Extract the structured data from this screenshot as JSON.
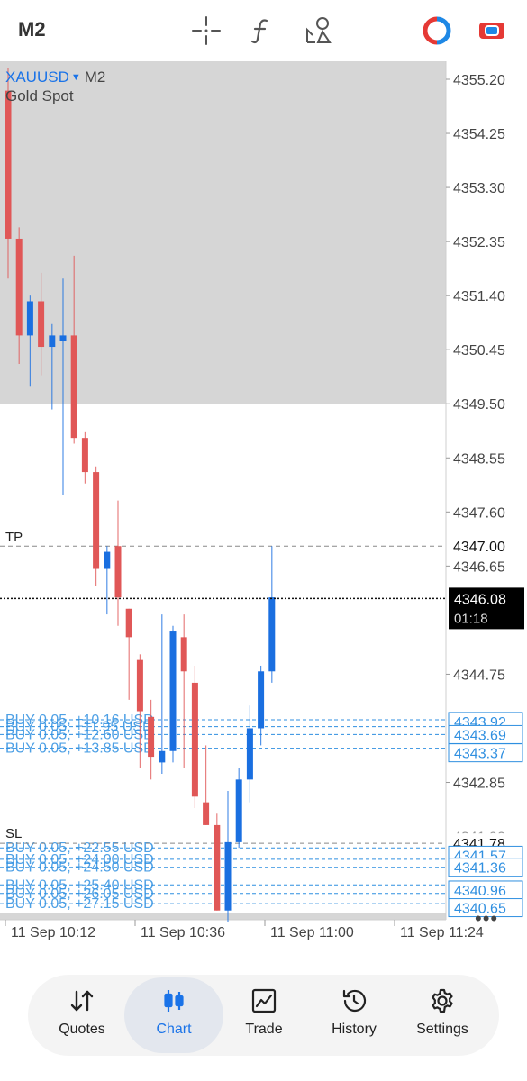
{
  "toolbar": {
    "timeframe": "M2",
    "icons": [
      "crosshair-icon",
      "function-icon",
      "objects-icon",
      "one-click-trading-icon",
      "account-icon"
    ]
  },
  "chart": {
    "symbol": "XAUUSD",
    "timeframe": "M2",
    "description": "Gold Spot",
    "price_range": [
      4340.35,
      4355.6
    ],
    "price_labels": [
      "4355.20",
      "4354.25",
      "4353.30",
      "4352.35",
      "4351.40",
      "4350.45",
      "4349.50",
      "4348.55",
      "4347.60",
      "4346.65",
      "4344.75",
      "4342.85"
    ],
    "time_labels": [
      "11 Sep 10:12",
      "11 Sep 10:36",
      "11 Sep 11:00",
      "11 Sep 11:24"
    ],
    "current_price": "4346.08",
    "bar_countdown": "01:18",
    "tp": {
      "label": "TP",
      "price": "4347.00"
    },
    "sl": {
      "label": "SL",
      "price": "4341.78"
    },
    "position_tags": [
      "4343.92",
      "4343.69",
      "4343.37",
      "4341.57",
      "4341.36",
      "4340.96",
      "4340.65"
    ],
    "partial_price_label": "4341.90",
    "orders_upper": [
      {
        "text": "BUY 0.05, +10.16 USD",
        "price": 4343.95
      },
      {
        "text": "BUY 0.05, +11.95 USD",
        "price": 4343.83
      },
      {
        "text": "BUY 0.05, +12.60 USD",
        "price": 4343.69
      },
      {
        "text": "BUY 0.05, +13.85 USD",
        "price": 4343.45
      }
    ],
    "orders_lower": [
      {
        "text": "BUY 0.05, +22.55 USD",
        "price": 4341.7
      },
      {
        "text": "BUY 0.05, +24.00 USD",
        "price": 4341.5
      },
      {
        "text": "BUY 0.05, +24.50 USD",
        "price": 4341.36
      },
      {
        "text": "BUY 0.05, +25.40 USD",
        "price": 4341.05
      },
      {
        "text": "BUY 0.05, +26.05 USD",
        "price": 4340.9
      },
      {
        "text": "BUY 0.05, +27.15 USD",
        "price": 4340.72
      }
    ],
    "candles": [
      {
        "o": 4355.0,
        "h": 4355.4,
        "l": 4351.7,
        "c": 4352.4
      },
      {
        "o": 4352.4,
        "h": 4352.6,
        "l": 4350.2,
        "c": 4350.7
      },
      {
        "o": 4350.7,
        "h": 4351.4,
        "l": 4349.8,
        "c": 4351.3
      },
      {
        "o": 4351.3,
        "h": 4351.8,
        "l": 4350.0,
        "c": 4350.5
      },
      {
        "o": 4350.5,
        "h": 4350.9,
        "l": 4349.4,
        "c": 4350.7
      },
      {
        "o": 4350.6,
        "h": 4351.7,
        "l": 4347.9,
        "c": 4350.7
      },
      {
        "o": 4350.7,
        "h": 4352.1,
        "l": 4348.8,
        "c": 4348.9
      },
      {
        "o": 4348.9,
        "h": 4349.0,
        "l": 4348.1,
        "c": 4348.3
      },
      {
        "o": 4348.3,
        "h": 4348.4,
        "l": 4346.3,
        "c": 4346.6
      },
      {
        "o": 4346.6,
        "h": 4347.0,
        "l": 4345.8,
        "c": 4346.9
      },
      {
        "o": 4347.0,
        "h": 4347.8,
        "l": 4345.6,
        "c": 4346.1
      },
      {
        "o": 4345.9,
        "h": 4345.9,
        "l": 4344.3,
        "c": 4345.4
      },
      {
        "o": 4345.0,
        "h": 4345.1,
        "l": 4343.1,
        "c": 4344.1
      },
      {
        "o": 4344.0,
        "h": 4344.3,
        "l": 4342.9,
        "c": 4343.3
      },
      {
        "o": 4343.2,
        "h": 4345.8,
        "l": 4343.0,
        "c": 4343.4
      },
      {
        "o": 4343.4,
        "h": 4345.6,
        "l": 4343.2,
        "c": 4345.5
      },
      {
        "o": 4345.4,
        "h": 4345.8,
        "l": 4343.1,
        "c": 4344.8
      },
      {
        "o": 4344.6,
        "h": 4344.9,
        "l": 4342.4,
        "c": 4342.6
      },
      {
        "o": 4342.5,
        "h": 4343.5,
        "l": 4342.1,
        "c": 4342.1
      },
      {
        "o": 4342.1,
        "h": 4342.3,
        "l": 4340.6,
        "c": 4340.6
      },
      {
        "o": 4340.6,
        "h": 4342.7,
        "l": 4340.4,
        "c": 4341.8
      },
      {
        "o": 4341.8,
        "h": 4343.1,
        "l": 4341.7,
        "c": 4342.9
      },
      {
        "o": 4342.9,
        "h": 4344.2,
        "l": 4342.5,
        "c": 4343.8
      },
      {
        "o": 4343.8,
        "h": 4344.9,
        "l": 4343.5,
        "c": 4344.8
      },
      {
        "o": 4344.8,
        "h": 4347.0,
        "l": 4344.6,
        "c": 4346.1
      }
    ]
  },
  "colors": {
    "bull": "#1a6fe0",
    "bear": "#e05757",
    "order_line": "#2f8fe0",
    "grey_zone": "#d6d6d6",
    "price_tag_bg": "#000000"
  },
  "nav": {
    "quotes": "Quotes",
    "chart": "Chart",
    "trade": "Trade",
    "history": "History",
    "settings": "Settings"
  }
}
